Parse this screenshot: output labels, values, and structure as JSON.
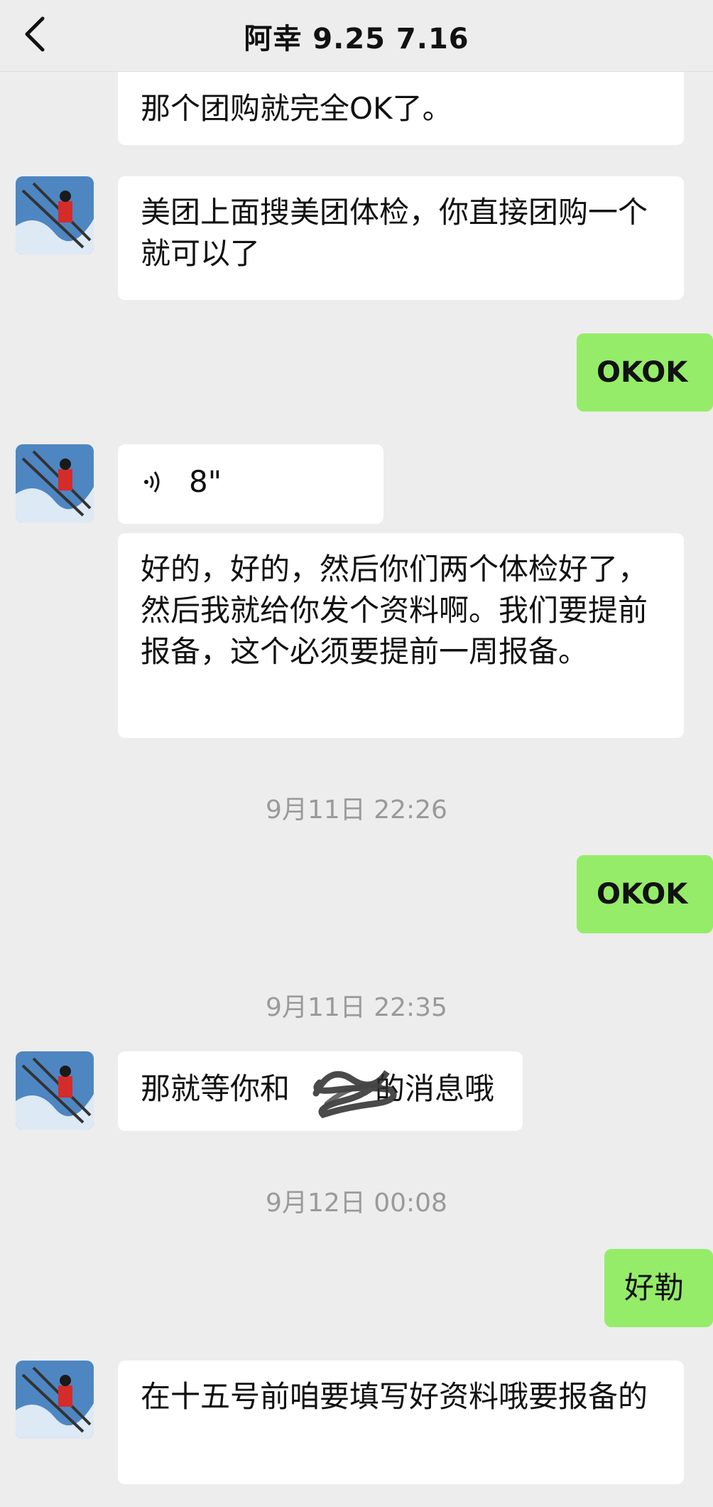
{
  "header": {
    "title": "阿幸 9.25 7.16",
    "back_icon": "chevron-left-icon"
  },
  "messages": {
    "m0": {
      "text": "那个团购就完全OK了。"
    },
    "m1": {
      "text": "美团上面搜美团体检，你直接团购一个就可以了"
    },
    "m2": {
      "text": "OKOK"
    },
    "m3": {
      "duration": "8\"",
      "icon": "voice-wave-icon"
    },
    "m4": {
      "text": "好的，好的，然后你们两个体检好了，然后我就给你发个资料啊。我们要提前报备，这个必须要提前一周报备。"
    },
    "t1": {
      "text": "9月11日 22:26"
    },
    "m5": {
      "text": "OKOK"
    },
    "t2": {
      "text": "9月11日 22:35"
    },
    "m6": {
      "text": "那就等你和"
    },
    "m6b": {
      "text": "的消息哦"
    },
    "t3": {
      "text": "9月12日 00:08"
    },
    "m7": {
      "text": "好勒"
    },
    "m8": {
      "text": "在十五号前咱要填写好资料哦要报备的"
    }
  },
  "colors": {
    "background": "#EDEDED",
    "bubble_left": "#FFFFFF",
    "bubble_right": "#95EC69",
    "timestamp": "#9A9A9A"
  }
}
